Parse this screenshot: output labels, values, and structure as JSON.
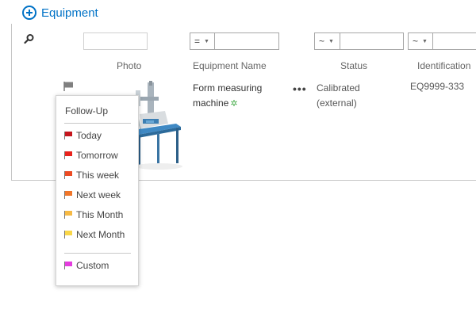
{
  "header": {
    "new_item_label": "Equipment"
  },
  "filters": {
    "name_operator": "=",
    "status_operator": "~",
    "id_operator": "~"
  },
  "columns": {
    "photo": "Photo",
    "name": "Equipment Name",
    "status": "Status",
    "identification": "Identification"
  },
  "row": {
    "name_line1": "Form measuring",
    "name_line2": "machine",
    "new_marker": "✲",
    "ellipsis": "•••",
    "status_line1": "Calibrated",
    "status_line2": "(external)",
    "identification": "EQ9999-333"
  },
  "followup_menu": {
    "title": "Follow-Up",
    "items": [
      {
        "label": "Today",
        "color": "#c5161d"
      },
      {
        "label": "Tomorrow",
        "color": "#e8231c"
      },
      {
        "label": "This week",
        "color": "#ec4b23"
      },
      {
        "label": "Next week",
        "color": "#f0762a"
      },
      {
        "label": "This Month",
        "color": "#f6b944"
      },
      {
        "label": "Next Month",
        "color": "#f9d648"
      },
      {
        "label": "Custom",
        "color": "#e43dde"
      }
    ]
  },
  "colors": {
    "accent": "#0072c6",
    "row_flag": "#808080"
  }
}
